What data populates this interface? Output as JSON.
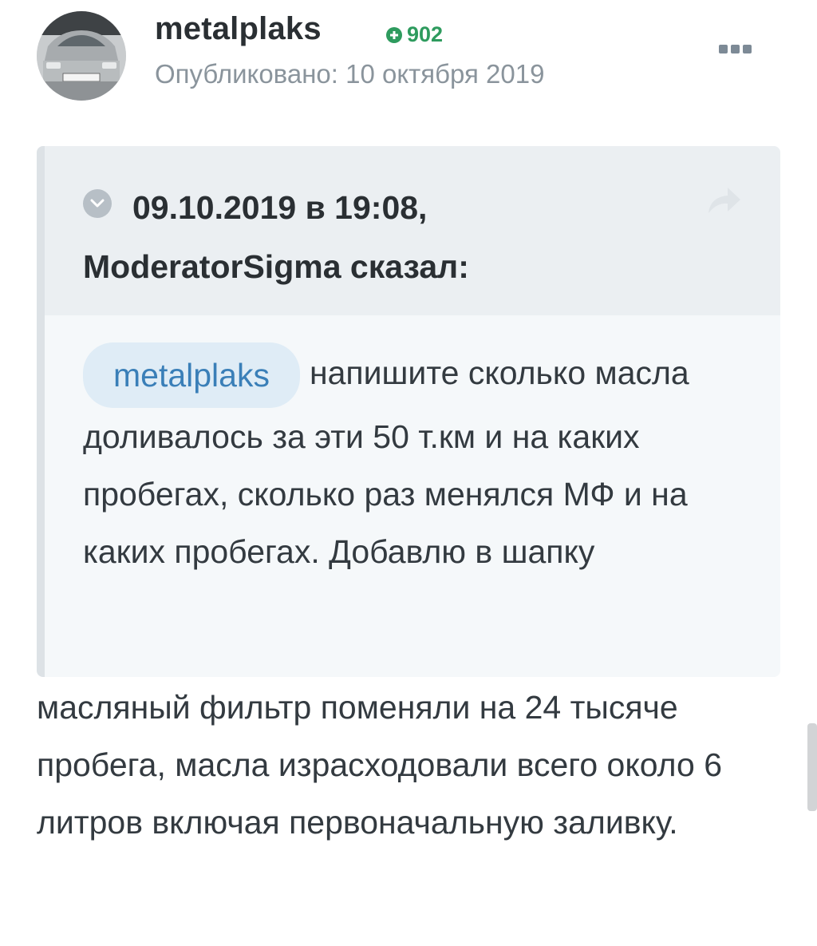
{
  "post": {
    "author": "metalplaks",
    "reputation": "902",
    "published_label": "Опубликовано:",
    "published_date": "10 октября 2019",
    "more_icon": "more-icon"
  },
  "quote": {
    "citation": "09.10.2019 в 19:08, ModeratorSigma сказал:",
    "mention": "metalplaks",
    "text": "напишите сколько масла доливалось за эти 50 т.км  и на каких пробегах, сколько раз менялся МФ и на каких пробегах. Добавлю в шапку"
  },
  "reply": {
    "text": "масляный фильтр поменяли на 24 тысяче пробега, масла израсходовали всего около 6 литров включая первоначальную заливку."
  },
  "colors": {
    "reputation": "#2e9b5e",
    "mention_bg": "#dfecf6",
    "mention_text": "#3a7fb8",
    "quote_head_bg": "#ebeff2",
    "quote_body_bg": "#f5f8fa"
  }
}
